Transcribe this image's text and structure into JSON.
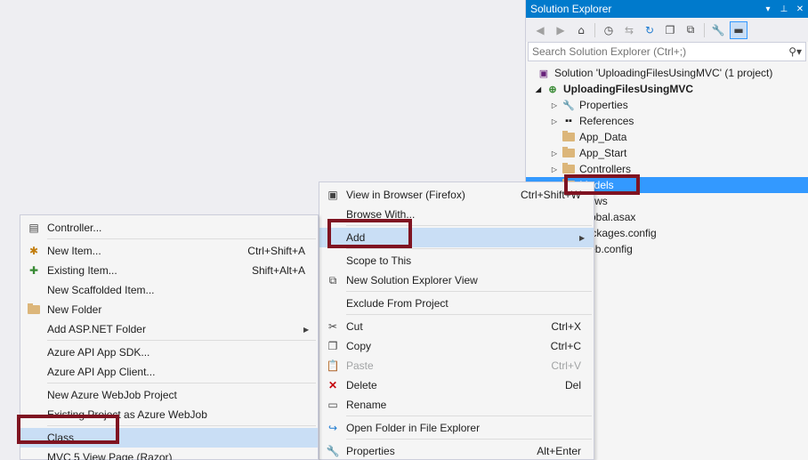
{
  "solution_explorer": {
    "title": "Solution Explorer",
    "search": {
      "placeholder": "Search Solution Explorer (Ctrl+;)"
    },
    "tree": [
      {
        "label": "Solution 'UploadingFilesUsingMVC' (1 project)"
      },
      {
        "label": "UploadingFilesUsingMVC"
      },
      {
        "label": "Properties"
      },
      {
        "label": "References"
      },
      {
        "label": "App_Data"
      },
      {
        "label": "App_Start"
      },
      {
        "label": "Controllers"
      },
      {
        "label": "Models"
      },
      {
        "label": "Views"
      },
      {
        "label": "Global.asax"
      },
      {
        "label": "packages.config"
      },
      {
        "label": "Web.config"
      }
    ]
  },
  "context_menu": {
    "items": [
      {
        "label": "View in Browser (Firefox)",
        "shortcut": "Ctrl+Shift+W"
      },
      {
        "label": "Browse With..."
      },
      {
        "label": "Add"
      },
      {
        "label": "Scope to This"
      },
      {
        "label": "New Solution Explorer View"
      },
      {
        "label": "Exclude From Project"
      },
      {
        "label": "Cut",
        "shortcut": "Ctrl+X"
      },
      {
        "label": "Copy",
        "shortcut": "Ctrl+C"
      },
      {
        "label": "Paste",
        "shortcut": "Ctrl+V"
      },
      {
        "label": "Delete",
        "shortcut": "Del"
      },
      {
        "label": "Rename"
      },
      {
        "label": "Open Folder in File Explorer"
      },
      {
        "label": "Properties",
        "shortcut": "Alt+Enter"
      }
    ]
  },
  "add_submenu": {
    "items": [
      {
        "label": "Controller..."
      },
      {
        "label": "New Item...",
        "shortcut": "Ctrl+Shift+A"
      },
      {
        "label": "Existing Item...",
        "shortcut": "Shift+Alt+A"
      },
      {
        "label": "New Scaffolded Item..."
      },
      {
        "label": "New Folder"
      },
      {
        "label": "Add ASP.NET Folder"
      },
      {
        "label": "Azure API App SDK..."
      },
      {
        "label": "Azure API App Client..."
      },
      {
        "label": "New Azure WebJob Project"
      },
      {
        "label": "Existing Project as Azure WebJob"
      },
      {
        "label": "Class"
      },
      {
        "label": "MVC 5 View Page (Razor)"
      }
    ]
  },
  "colors": {
    "accent": "#007acc",
    "selection": "#3399ff",
    "menu_highlight": "#c9def5",
    "annotation_box": "#7f1321"
  }
}
